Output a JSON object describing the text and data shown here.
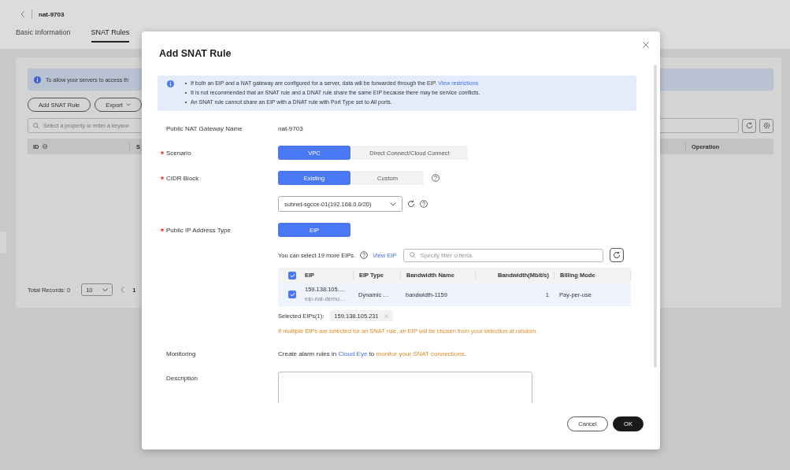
{
  "page": {
    "title": "nat-9703",
    "tabs": [
      {
        "label": "Basic Information",
        "selected": false
      },
      {
        "label": "SNAT Rules",
        "selected": true
      }
    ],
    "banner": "To allow your servers to access th",
    "add_button": "Add SNAT Rule",
    "export_button": "Export",
    "search_placeholder": "Select a property or enter a keywor",
    "columns": [
      "ID",
      "S",
      "Operation"
    ],
    "total": "Total Records: 0",
    "page_size": "10",
    "page_number": "1"
  },
  "dialog": {
    "title": "Add SNAT Rule",
    "notices": [
      {
        "text": "If both an EIP and a NAT gateway are configured for a server, data will be forwarded through the EIP.",
        "link": "View restrictions"
      },
      {
        "text": "It is not recommended that an SNAT rule and a DNAT rule share the same EIP because there may be service conflicts."
      },
      {
        "text": "An SNAT rule cannot share an EIP with a DNAT rule with Port Type set to All ports."
      }
    ],
    "gateway_name": {
      "label": "Public NAT Gateway Name",
      "required": false,
      "value": "nat-9703"
    },
    "scenario": {
      "label": "Scenario",
      "required": true,
      "options": [
        {
          "label": "VPC",
          "selected": true
        },
        {
          "label": "Direct Connect/Cloud Connect",
          "selected": false
        }
      ]
    },
    "cidr_block": {
      "label": "CIDR Block",
      "required": true,
      "options": [
        {
          "label": "Existing",
          "selected": true
        },
        {
          "label": "Custom",
          "selected": false
        }
      ]
    },
    "subnet": {
      "value": "subnet-sgcce-01(192.168.0.0/20)"
    },
    "ip_type": {
      "label": "Public IP Address Type",
      "required": true,
      "options": [
        {
          "label": "EIP",
          "selected": true
        }
      ]
    },
    "eips": {
      "quota": "You can select 19 more EIPs.",
      "view_link": "View EIP",
      "filter_placeholder": "Specify filter criteria.",
      "all_checked": true,
      "columns": [
        "EIP",
        "EIP Type",
        "Bandwidth Name",
        "Bandwidth(Mbit/s)",
        "Billing Mode"
      ],
      "rows": [
        {
          "checked": true,
          "eip": "159.138.105.…",
          "eip_name": "eip-nat-demo…",
          "type": "Dynamic …",
          "bandwidth_name": "bandwidth-1159",
          "bandwidth": "1",
          "billing": "Pay-per-use"
        }
      ],
      "selected_label": "Selected EIPs(1):",
      "selected_tags": [
        "159.138.105.231"
      ],
      "warning": "If multiple EIPs are selected for an SNAT rule, an EIP will be chosen from your selection at random."
    },
    "monitoring": {
      "label": "Monitoring",
      "text_before": "Create alarm rules in",
      "link": "Cloud Eye",
      "text_middle": "to",
      "link_2": "monitor your SNAT connections",
      "text_after": "."
    },
    "description": {
      "label": "Description"
    },
    "buttons": [
      {
        "label": "Cancel",
        "kind": "secondary"
      },
      {
        "label": "OK",
        "kind": "primary"
      }
    ]
  }
}
